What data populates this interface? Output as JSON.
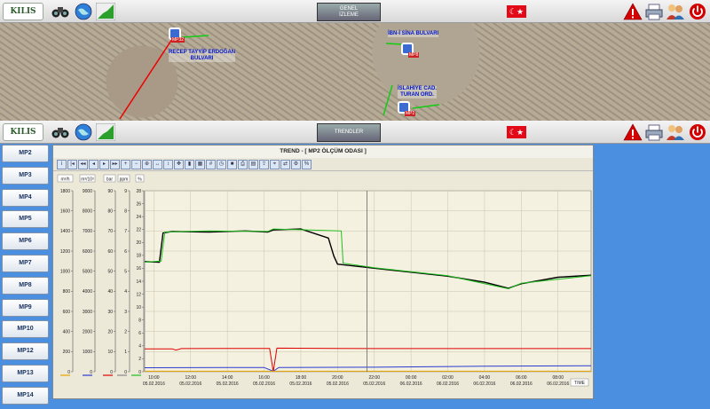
{
  "top_bar": {
    "logo": "KILIS",
    "tab": [
      "GENEL",
      "İZLEME"
    ],
    "icons": [
      "binoculars-icon",
      "globe-icon",
      "trend-chart-icon"
    ],
    "right_icons": [
      "warning-icon",
      "printer-icon",
      "users-icon",
      "power-icon"
    ]
  },
  "mid_bar": {
    "logo": "KILIS",
    "tab": [
      "TRENDLER"
    ]
  },
  "map": {
    "labels": {
      "left": [
        "RECEP TAYYİP ERDOĞAN",
        "BULVARI"
      ],
      "right_top": "İBN-İ SİNA BULVARI",
      "right_bottom": [
        "İSLAHİYE CAD.",
        "TURAN ORD."
      ]
    },
    "pins": [
      "MP32",
      "MP8",
      "MP2"
    ]
  },
  "sidebar": {
    "items": [
      "MP2",
      "MP3",
      "MP4",
      "MP5",
      "MP6",
      "MP7",
      "MP8",
      "MP9",
      "MP10",
      "MP12",
      "MP13",
      "MP14"
    ]
  },
  "trend": {
    "title": "TREND - [ MP2 ÖLÇÜM ODASI ]",
    "time_button": "TIME"
  },
  "chart_data": {
    "type": "line",
    "axes": [
      {
        "unit": "m³/h",
        "ylim": [
          0,
          1800
        ],
        "ticks": [
          0,
          200,
          400,
          600,
          800,
          1000,
          1200,
          1400,
          1600,
          1800
        ]
      },
      {
        "unit": "m³/10³",
        "ylim": [
          0,
          9000
        ],
        "ticks": [
          0,
          1000,
          2000,
          3000,
          4000,
          5000,
          6000,
          7000,
          8000,
          9000
        ]
      },
      {
        "unit": "bar",
        "ylim": [
          0,
          90
        ],
        "ticks": [
          0,
          10,
          20,
          30,
          40,
          50,
          60,
          70,
          80,
          90
        ]
      },
      {
        "unit": "ppm",
        "ylim": [
          0,
          9
        ],
        "ticks": [
          0,
          1,
          2,
          3,
          4,
          5,
          6,
          7,
          8,
          9
        ]
      },
      {
        "unit": "%",
        "ylim": [
          0,
          28
        ],
        "ticks": [
          0,
          2,
          4,
          6,
          8,
          10,
          12,
          14,
          16,
          18,
          20,
          22,
          24,
          26,
          28
        ]
      }
    ],
    "x_ticks": [
      "10:00",
      "12:00",
      "14:00",
      "16:00",
      "18:00",
      "20:00",
      "22:00",
      "00:00",
      "02:00",
      "04:00",
      "06:00",
      "08:00"
    ],
    "x_dates": [
      "05.02.2016",
      "05.02.2016",
      "05.02.2016",
      "05.02.2016",
      "05.02.2016",
      "05.02.2016",
      "05.02.2016",
      "06.02.2016",
      "06.02.2016",
      "06.02.2016",
      "06.02.2016",
      "06.02.2016"
    ],
    "x_hours_range": [
      9.5,
      33.8
    ],
    "series": [
      {
        "color": "#000000",
        "points": [
          [
            9.5,
            1095
          ],
          [
            10.3,
            1090
          ],
          [
            10.5,
            1380
          ],
          [
            11,
            1395
          ],
          [
            13,
            1390
          ],
          [
            15,
            1400
          ],
          [
            16.2,
            1390
          ],
          [
            16.5,
            1410
          ],
          [
            18,
            1420
          ],
          [
            19.5,
            1330
          ],
          [
            19.8,
            1150
          ],
          [
            20,
            1070
          ],
          [
            22,
            1030
          ],
          [
            26,
            950
          ],
          [
            28,
            890
          ],
          [
            29.3,
            830
          ],
          [
            30,
            875
          ],
          [
            32,
            940
          ],
          [
            33.8,
            960
          ]
        ]
      },
      {
        "color": "#1fbf1f",
        "points": [
          [
            9.5,
            1090
          ],
          [
            10.4,
            1100
          ],
          [
            10.6,
            1390
          ],
          [
            13,
            1400
          ],
          [
            16.2,
            1395
          ],
          [
            16.5,
            1420
          ],
          [
            18.5,
            1410
          ],
          [
            20.2,
            1400
          ],
          [
            20.3,
            1080
          ],
          [
            22,
            1035
          ],
          [
            26,
            955
          ],
          [
            29.3,
            825
          ],
          [
            30,
            880
          ],
          [
            33.8,
            955
          ]
        ]
      },
      {
        "color": "#e00000",
        "points": [
          [
            9.5,
            228
          ],
          [
            11,
            228
          ],
          [
            11.2,
            215
          ],
          [
            11.5,
            230
          ],
          [
            16.3,
            232
          ],
          [
            16.5,
            0
          ],
          [
            16.7,
            235
          ],
          [
            22,
            230
          ],
          [
            33.8,
            230
          ]
        ]
      },
      {
        "color": "#2b3bd0",
        "points": [
          [
            9.5,
            40
          ],
          [
            16,
            42
          ],
          [
            16.5,
            5
          ],
          [
            16.8,
            42
          ],
          [
            22,
            45
          ],
          [
            28,
            55
          ],
          [
            33.8,
            60
          ]
        ]
      },
      {
        "color": "#e8a400",
        "points": [
          [
            9.5,
            5
          ],
          [
            33.8,
            5
          ]
        ]
      }
    ],
    "cursor_hour": 21.6,
    "grid": true
  }
}
